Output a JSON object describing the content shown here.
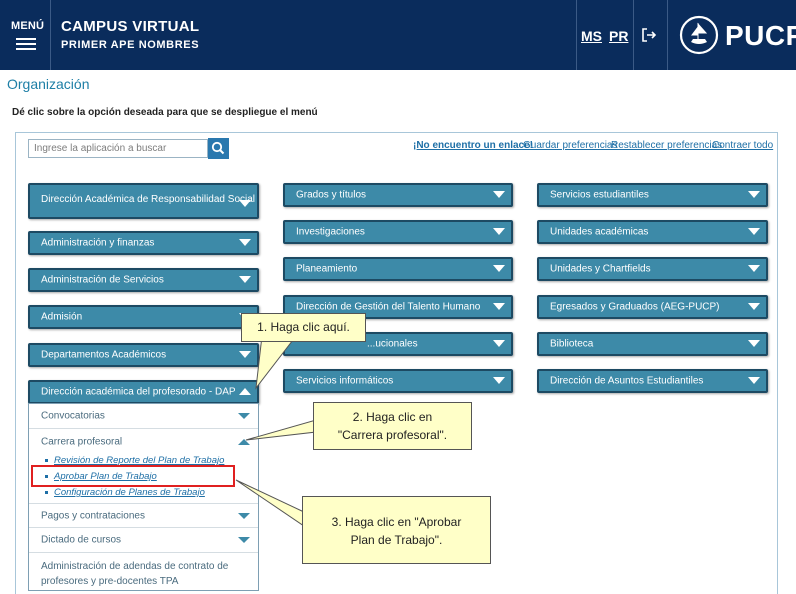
{
  "header": {
    "menu_label": "MENÚ",
    "app_title": "CAMPUS VIRTUAL",
    "user_name": "PRIMER APE NOMBRES",
    "link_ms": "MS",
    "link_pr": "PR",
    "logo_text": "PUCP",
    "bg_color": "#0a2c5c"
  },
  "page": {
    "title": "Organización",
    "instruction": "Dé clic sobre la opción deseada para que se despliegue el menú"
  },
  "search": {
    "placeholder": "Ingrese la aplicación a buscar",
    "icon": "search-icon"
  },
  "toplinks": {
    "not_found": "¡No encuentro un enlace!",
    "save": "Guardar preferencias",
    "reset": "Restablecer preferencias",
    "collapse": "Contraer todo"
  },
  "column1": [
    {
      "label": "Dirección Académica de Responsabilidad Social",
      "expanded": false
    },
    {
      "label": "Administración y finanzas",
      "expanded": false
    },
    {
      "label": "Administración de Servicios",
      "expanded": false
    },
    {
      "label": "Admisión",
      "expanded": false
    },
    {
      "label": "Departamentos Académicos",
      "expanded": false
    },
    {
      "label": "Dirección académica del profesorado - DAP",
      "expanded": true
    }
  ],
  "dap_submenu": [
    {
      "label": "Convocatorias",
      "expanded": false
    },
    {
      "label": "Carrera profesoral",
      "expanded": true
    },
    {
      "label": "Pagos y contrataciones",
      "expanded": false
    },
    {
      "label": "Dictado de cursos",
      "expanded": false
    },
    {
      "label": "Administración de adendas de contrato de profesores y pre-docentes TPA",
      "expanded": false
    }
  ],
  "carrera_links": [
    "Revisión de Reporte del Plan de Trabajo",
    "Aprobar Plan de Trabajo",
    "Configuración de Planes de Trabajo"
  ],
  "column2": [
    {
      "label": "Grados y títulos"
    },
    {
      "label": "Investigaciones"
    },
    {
      "label": "Planeamiento"
    },
    {
      "label": "Dirección de Gestión del Talento Humano"
    },
    {
      "label": "...ucionales"
    },
    {
      "label": "Servicios informáticos"
    }
  ],
  "column3": [
    {
      "label": "Servicios estudiantiles"
    },
    {
      "label": "Unidades académicas"
    },
    {
      "label": "Unidades y Chartfields"
    },
    {
      "label": "Egresados y Graduados (AEG-PUCP)"
    },
    {
      "label": "Biblioteca"
    },
    {
      "label": "Dirección de Asuntos Estudiantiles"
    }
  ],
  "callouts": {
    "step1": "1. Haga clic aquí.",
    "step2_line1": "2. Haga clic en",
    "step2_line2": "\"Carrera profesoral\".",
    "step3_line1": "3. Haga clic en \"Aprobar",
    "step3_line2": "Plan de Trabajo\"."
  },
  "colors": {
    "accordion": "#3d8aa8",
    "accent_text": "#1e7fa6",
    "callout_bg": "#ffffc8",
    "highlight": "#e02020"
  }
}
